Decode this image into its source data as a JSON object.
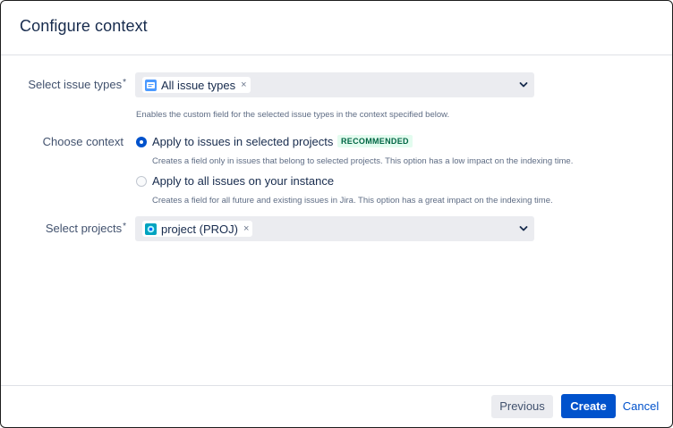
{
  "dialog": {
    "title": "Configure context"
  },
  "issue_types": {
    "label": "Select issue types",
    "required_mark": "*",
    "selected_tag": "All issue types",
    "remove_glyph": "×",
    "help": "Enables the custom field for the selected issue types in the context specified below."
  },
  "context": {
    "label": "Choose context",
    "options": [
      {
        "label": "Apply to issues in selected projects",
        "badge": "RECOMMENDED",
        "help": "Creates a field only in issues that belong to selected projects. This option has a low impact on the indexing time.",
        "selected": true
      },
      {
        "label": "Apply to all issues on your instance",
        "help": "Creates a field for all future and existing issues in Jira. This option has a great impact on the indexing time.",
        "selected": false
      }
    ]
  },
  "projects": {
    "label": "Select projects",
    "required_mark": "*",
    "selected_tag": "project (PROJ)",
    "remove_glyph": "×"
  },
  "footer": {
    "previous_label": "Previous",
    "create_label": "Create",
    "cancel_label": "Cancel"
  },
  "colors": {
    "primary": "#0052cc",
    "text": "#172b4d",
    "subtle_text": "#5e6c84",
    "field_bg": "#ebecf0",
    "success_bg": "#e3fcef",
    "success_text": "#006644"
  }
}
